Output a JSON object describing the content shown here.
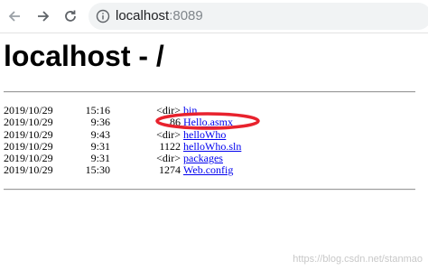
{
  "browser": {
    "url_host": "localhost",
    "url_port": ":8089"
  },
  "page": {
    "title": "localhost - /"
  },
  "listing": [
    {
      "date": "2019/10/29",
      "time": "15:16",
      "size": "<dir>",
      "name": "bin"
    },
    {
      "date": "2019/10/29",
      "time": "9:36",
      "size": "86",
      "name": "Hello.asmx"
    },
    {
      "date": "2019/10/29",
      "time": "9:43",
      "size": "<dir>",
      "name": "helloWho"
    },
    {
      "date": "2019/10/29",
      "time": "9:31",
      "size": "1122",
      "name": "helloWho.sln"
    },
    {
      "date": "2019/10/29",
      "time": "9:31",
      "size": "<dir>",
      "name": "packages"
    },
    {
      "date": "2019/10/29",
      "time": "15:30",
      "size": "1274",
      "name": "Web.config"
    }
  ],
  "annotation": {
    "color": "#e8222d"
  },
  "watermark": "https://blog.csdn.net/stanmao"
}
